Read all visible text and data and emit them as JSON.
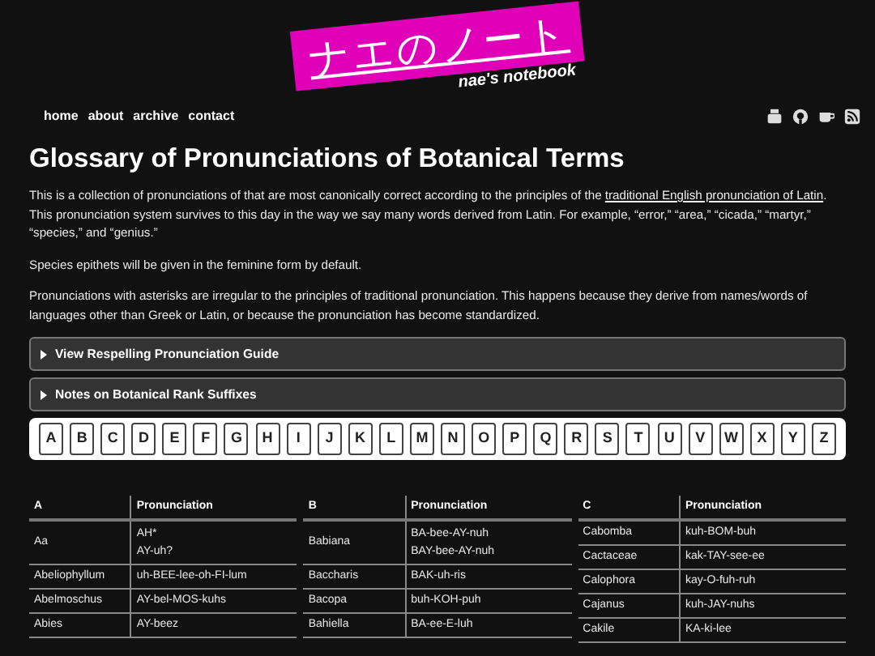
{
  "logo": {
    "title": "ナエのノート",
    "subtitle": "nae's notebook"
  },
  "nav": {
    "links": [
      "home",
      "about",
      "archive",
      "contact"
    ]
  },
  "page": {
    "title": "Glossary of Pronunciations of Botanical Terms",
    "paragraphs": [
      {
        "before": "This is a collection of pronunciations of that are most canonically correct according to the principles of the ",
        "link": "traditional English pronunciation of Latin",
        "after": ". This pronunciation system survives to this day in the way we say many words derived from Latin. For example, “error,” “area,” “cicada,” “martyr,” “species,” and “genius.”"
      },
      {
        "before": "Species epithets will be given in the feminine form by default."
      },
      {
        "before": "Pronunciations with asterisks are irregular to the principles of traditional pronunciation. This happens because they derive from names/words of languages other than Greek or Latin, or because the pronunciation has become standardized."
      }
    ],
    "sections": [
      {
        "label": "View Respelling Pronunciation Guide",
        "expanded": false
      },
      {
        "label": "Notes on Botanical Rank Suffixes",
        "expanded": false
      }
    ],
    "letters": [
      "A",
      "B",
      "C",
      "D",
      "E",
      "F",
      "G",
      "H",
      "I",
      "J",
      "K",
      "L",
      "M",
      "N",
      "O",
      "P",
      "Q",
      "R",
      "S",
      "T",
      "U",
      "V",
      "W",
      "X",
      "Y",
      "Z"
    ],
    "tables": [
      {
        "heading": "A",
        "column_2": "Pronunciation",
        "rows": [
          {
            "term": "Aa",
            "pronunciations": [
              "AH*",
              "AY-uh?"
            ]
          },
          {
            "term": "Abeliophyllum",
            "pronunciations": [
              "uh-BEE-lee-oh-FI-lum"
            ]
          },
          {
            "term": "Abelmoschus",
            "pronunciations": [
              "AY-bel-MOS-kuhs"
            ]
          },
          {
            "term": "Abies",
            "pronunciations": [
              "AY-beez"
            ]
          }
        ]
      },
      {
        "heading": "B",
        "column_2": "Pronunciation",
        "rows": [
          {
            "term": "Babiana",
            "pronunciations": [
              "BA-bee-AY-nuh",
              "BAY-bee-AY-nuh"
            ]
          },
          {
            "term": "Baccharis",
            "pronunciations": [
              "BAK-uh-ris"
            ]
          },
          {
            "term": "Bacopa",
            "pronunciations": [
              "buh-KOH-puh"
            ]
          },
          {
            "term": "Bahiella",
            "pronunciations": [
              "BA-ee-E-luh"
            ]
          }
        ]
      },
      {
        "heading": "C",
        "column_2": "Pronunciation",
        "rows": [
          {
            "term": "Cabomba",
            "pronunciations": [
              "kuh-BOM-buh"
            ]
          },
          {
            "term": "Cactaceae",
            "pronunciations": [
              "kak-TAY-see-ee"
            ]
          },
          {
            "term": "Calophora",
            "pronunciations": [
              "kay-O-fuh-ruh"
            ]
          },
          {
            "term": "Cajanus",
            "pronunciations": [
              "kuh-JAY-nuhs"
            ]
          },
          {
            "term": "Cakile",
            "pronunciations": [
              "KA-ki-lee"
            ]
          }
        ]
      }
    ]
  }
}
